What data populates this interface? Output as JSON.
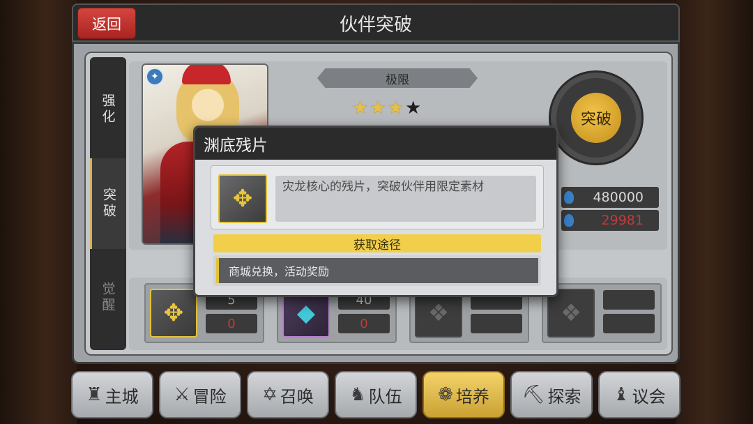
{
  "header": {
    "back_label": "返回",
    "title": "伙伴突破"
  },
  "side_tabs": [
    {
      "label": "强化",
      "active": false
    },
    {
      "label": "突破",
      "active": true
    },
    {
      "label": "觉醒",
      "active": false
    }
  ],
  "partner": {
    "rank_label": "极限",
    "stars_filled": 3,
    "stars_total": 4,
    "stars_text": {
      "filled": "★★★",
      "empty": "★"
    }
  },
  "breakthrough": {
    "button_label": "突破"
  },
  "resources": [
    {
      "icon": "blue-crystal-icon",
      "value": "480000"
    },
    {
      "icon": "blue-crystal-icon",
      "value": "29981"
    }
  ],
  "materials": [
    {
      "icon": "abyss-fragment-icon",
      "have": "5",
      "need": "0"
    },
    {
      "icon": "blue-crystal-icon",
      "have": "40",
      "need": "0"
    },
    {
      "icon": "locked-slot-icon",
      "have": "",
      "need": ""
    },
    {
      "icon": "locked-slot-icon",
      "have": "",
      "need": ""
    }
  ],
  "dialog": {
    "title": "渊底残片",
    "description": "灾龙核心的残片，突破伙伴用限定素材",
    "obtain_header": "获取途径",
    "obtain_text": "商城兑换，活动奖励"
  },
  "nav": [
    {
      "label": "主城",
      "icon": "castle-icon",
      "active": false
    },
    {
      "label": "冒险",
      "icon": "crossed-swords-icon",
      "active": false
    },
    {
      "label": "召唤",
      "icon": "summon-circle-icon",
      "active": false
    },
    {
      "label": "队伍",
      "icon": "team-icon",
      "active": false
    },
    {
      "label": "培养",
      "icon": "cultivate-icon",
      "active": true
    },
    {
      "label": "探索",
      "icon": "explore-icon",
      "active": false
    },
    {
      "label": "议会",
      "icon": "council-icon",
      "active": false
    }
  ],
  "colors": {
    "accent_gold": "#e3c33a",
    "danger_red": "#c23a3a",
    "back_red": "#c8332e"
  }
}
